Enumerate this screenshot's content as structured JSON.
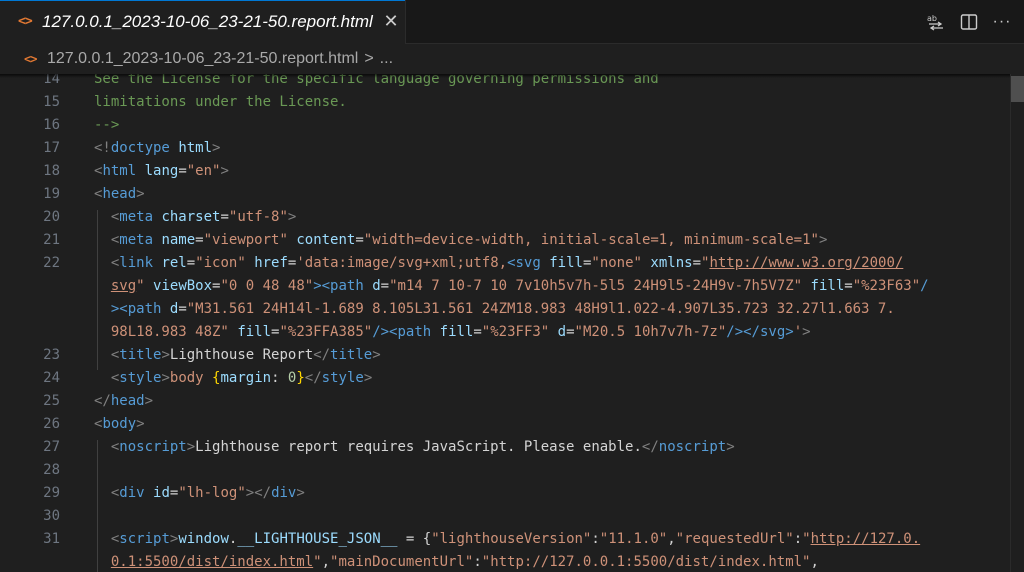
{
  "tab": {
    "icon": "<>",
    "title": "127.0.0.1_2023-10-06_23-21-50.report.html",
    "close": "✕"
  },
  "actions": {
    "icons": [
      "compare-changes-icon",
      "split-editor-icon",
      "more-actions-icon"
    ],
    "more": "···"
  },
  "breadcrumb": {
    "icon": "<>",
    "file": "127.0.0.1_2023-10-06_23-21-50.report.html",
    "separator": ">",
    "more": "..."
  },
  "editor": {
    "line_numbers": [
      "14",
      "15",
      "16",
      "17",
      "18",
      "19",
      "20",
      "21",
      "22",
      "23",
      "24",
      "25",
      "26",
      "27",
      "28",
      "29",
      "30",
      "31"
    ],
    "lines": [
      {
        "number": "14",
        "tokens": [
          {
            "t": "com",
            "v": "See the License for the specific language governing permissions and"
          }
        ]
      },
      {
        "number": "15",
        "tokens": [
          {
            "t": "com",
            "v": "limitations under the License."
          }
        ]
      },
      {
        "number": "16",
        "tokens": [
          {
            "t": "com",
            "v": "-->"
          }
        ]
      },
      {
        "number": "17",
        "tokens": [
          {
            "t": "br",
            "v": "<!"
          },
          {
            "t": "tag",
            "v": "doctype"
          },
          {
            "t": "txt",
            "v": " "
          },
          {
            "t": "attr",
            "v": "html"
          },
          {
            "t": "br",
            "v": ">"
          }
        ]
      },
      {
        "number": "18",
        "tokens": [
          {
            "t": "br",
            "v": "<"
          },
          {
            "t": "tag",
            "v": "html"
          },
          {
            "t": "txt",
            "v": " "
          },
          {
            "t": "attr",
            "v": "lang"
          },
          {
            "t": "txt",
            "v": "="
          },
          {
            "t": "str",
            "v": "\"en\""
          },
          {
            "t": "br",
            "v": ">"
          }
        ]
      },
      {
        "number": "19",
        "tokens": [
          {
            "t": "br",
            "v": "<"
          },
          {
            "t": "tag",
            "v": "head"
          },
          {
            "t": "br",
            "v": ">"
          }
        ]
      },
      {
        "number": "20",
        "tokens": [
          {
            "t": "txt",
            "v": "  "
          },
          {
            "t": "br",
            "v": "<"
          },
          {
            "t": "tag",
            "v": "meta"
          },
          {
            "t": "txt",
            "v": " "
          },
          {
            "t": "attr",
            "v": "charset"
          },
          {
            "t": "txt",
            "v": "="
          },
          {
            "t": "str",
            "v": "\"utf-8\""
          },
          {
            "t": "br",
            "v": ">"
          }
        ]
      },
      {
        "number": "21",
        "tokens": [
          {
            "t": "txt",
            "v": "  "
          },
          {
            "t": "br",
            "v": "<"
          },
          {
            "t": "tag",
            "v": "meta"
          },
          {
            "t": "txt",
            "v": " "
          },
          {
            "t": "attr",
            "v": "name"
          },
          {
            "t": "txt",
            "v": "="
          },
          {
            "t": "str",
            "v": "\"viewport\""
          },
          {
            "t": "txt",
            "v": " "
          },
          {
            "t": "attr",
            "v": "content"
          },
          {
            "t": "txt",
            "v": "="
          },
          {
            "t": "str",
            "v": "\"width=device-width, initial-scale=1, minimum-scale=1\""
          },
          {
            "t": "br",
            "v": ">"
          }
        ]
      },
      {
        "number": "22",
        "tokens": [
          {
            "t": "txt",
            "v": "  "
          },
          {
            "t": "br",
            "v": "<"
          },
          {
            "t": "tag",
            "v": "link"
          },
          {
            "t": "txt",
            "v": " "
          },
          {
            "t": "attr",
            "v": "rel"
          },
          {
            "t": "txt",
            "v": "="
          },
          {
            "t": "str",
            "v": "\"icon\""
          },
          {
            "t": "txt",
            "v": " "
          },
          {
            "t": "attr",
            "v": "href"
          },
          {
            "t": "txt",
            "v": "="
          },
          {
            "t": "str",
            "v": "'data:image/svg+xml;utf8,"
          },
          {
            "t": "tag",
            "v": "<svg"
          },
          {
            "t": "txt",
            "v": " "
          },
          {
            "t": "attr",
            "v": "fill"
          },
          {
            "t": "txt",
            "v": "="
          },
          {
            "t": "str",
            "v": "\"none\""
          },
          {
            "t": "txt",
            "v": " "
          },
          {
            "t": "attr",
            "v": "xmlns"
          },
          {
            "t": "txt",
            "v": "="
          },
          {
            "t": "str",
            "v": "\""
          },
          {
            "t": "link",
            "v": "http://www.w3.org/2000/"
          }
        ]
      },
      {
        "number": "",
        "tokens": [
          {
            "t": "txt",
            "v": "  "
          },
          {
            "t": "link",
            "v": "svg"
          },
          {
            "t": "str",
            "v": "\""
          },
          {
            "t": "txt",
            "v": " "
          },
          {
            "t": "attr",
            "v": "viewBox"
          },
          {
            "t": "txt",
            "v": "="
          },
          {
            "t": "str",
            "v": "\"0 0 48 48\""
          },
          {
            "t": "tag",
            "v": "><path"
          },
          {
            "t": "txt",
            "v": " "
          },
          {
            "t": "attr",
            "v": "d"
          },
          {
            "t": "txt",
            "v": "="
          },
          {
            "t": "str",
            "v": "\"m14 7 10-7 10 7v10h5v7h-5l5 24H9l5-24H9v-7h5V7Z\""
          },
          {
            "t": "txt",
            "v": " "
          },
          {
            "t": "attr",
            "v": "fill"
          },
          {
            "t": "txt",
            "v": "="
          },
          {
            "t": "str",
            "v": "\"%23F63\""
          },
          {
            "t": "tag",
            "v": "/"
          }
        ]
      },
      {
        "number": "",
        "tokens": [
          {
            "t": "txt",
            "v": "  "
          },
          {
            "t": "tag",
            "v": "><path"
          },
          {
            "t": "txt",
            "v": " "
          },
          {
            "t": "attr",
            "v": "d"
          },
          {
            "t": "txt",
            "v": "="
          },
          {
            "t": "str",
            "v": "\"M31.561 24H14l-1.689 8.105L31.561 24ZM18.983 48H9l1.022-4.907L35.723 32.27l1.663 7."
          }
        ]
      },
      {
        "number": "",
        "tokens": [
          {
            "t": "txt",
            "v": "  "
          },
          {
            "t": "str",
            "v": "98L18.983 48Z\""
          },
          {
            "t": "txt",
            "v": " "
          },
          {
            "t": "attr",
            "v": "fill"
          },
          {
            "t": "txt",
            "v": "="
          },
          {
            "t": "str",
            "v": "\"%23FFA385\""
          },
          {
            "t": "tag",
            "v": "/><path"
          },
          {
            "t": "txt",
            "v": " "
          },
          {
            "t": "attr",
            "v": "fill"
          },
          {
            "t": "txt",
            "v": "="
          },
          {
            "t": "str",
            "v": "\"%23FF3\""
          },
          {
            "t": "txt",
            "v": " "
          },
          {
            "t": "attr",
            "v": "d"
          },
          {
            "t": "txt",
            "v": "="
          },
          {
            "t": "str",
            "v": "\"M20.5 10h7v7h-7z\""
          },
          {
            "t": "tag",
            "v": "/></svg>"
          },
          {
            "t": "str",
            "v": "'"
          },
          {
            "t": "br",
            "v": ">"
          }
        ]
      },
      {
        "number": "23",
        "tokens": [
          {
            "t": "txt",
            "v": "  "
          },
          {
            "t": "br",
            "v": "<"
          },
          {
            "t": "tag",
            "v": "title"
          },
          {
            "t": "br",
            "v": ">"
          },
          {
            "t": "txt",
            "v": "Lighthouse Report"
          },
          {
            "t": "br",
            "v": "</"
          },
          {
            "t": "tag",
            "v": "title"
          },
          {
            "t": "br",
            "v": ">"
          }
        ]
      },
      {
        "number": "24",
        "tokens": [
          {
            "t": "txt",
            "v": "  "
          },
          {
            "t": "br",
            "v": "<"
          },
          {
            "t": "tag",
            "v": "style"
          },
          {
            "t": "br",
            "v": ">"
          },
          {
            "t": "str",
            "v": "body"
          },
          {
            "t": "txt",
            "v": " "
          },
          {
            "t": "brace",
            "v": "{"
          },
          {
            "t": "attr",
            "v": "margin"
          },
          {
            "t": "txt",
            "v": ": "
          },
          {
            "t": "num",
            "v": "0"
          },
          {
            "t": "brace",
            "v": "}"
          },
          {
            "t": "br",
            "v": "</"
          },
          {
            "t": "tag",
            "v": "style"
          },
          {
            "t": "br",
            "v": ">"
          }
        ]
      },
      {
        "number": "25",
        "tokens": [
          {
            "t": "br",
            "v": "</"
          },
          {
            "t": "tag",
            "v": "head"
          },
          {
            "t": "br",
            "v": ">"
          }
        ]
      },
      {
        "number": "26",
        "tokens": [
          {
            "t": "br",
            "v": "<"
          },
          {
            "t": "tag",
            "v": "body"
          },
          {
            "t": "br",
            "v": ">"
          }
        ]
      },
      {
        "number": "27",
        "tokens": [
          {
            "t": "txt",
            "v": "  "
          },
          {
            "t": "br",
            "v": "<"
          },
          {
            "t": "tag",
            "v": "noscript"
          },
          {
            "t": "br",
            "v": ">"
          },
          {
            "t": "txt",
            "v": "Lighthouse report requires JavaScript. Please enable."
          },
          {
            "t": "br",
            "v": "</"
          },
          {
            "t": "tag",
            "v": "noscript"
          },
          {
            "t": "br",
            "v": ">"
          }
        ]
      },
      {
        "number": "28",
        "tokens": []
      },
      {
        "number": "29",
        "tokens": [
          {
            "t": "txt",
            "v": "  "
          },
          {
            "t": "br",
            "v": "<"
          },
          {
            "t": "tag",
            "v": "div"
          },
          {
            "t": "txt",
            "v": " "
          },
          {
            "t": "attr",
            "v": "id"
          },
          {
            "t": "txt",
            "v": "="
          },
          {
            "t": "str",
            "v": "\"lh-log\""
          },
          {
            "t": "br",
            "v": "></"
          },
          {
            "t": "tag",
            "v": "div"
          },
          {
            "t": "br",
            "v": ">"
          }
        ]
      },
      {
        "number": "30",
        "tokens": []
      },
      {
        "number": "31",
        "tokens": [
          {
            "t": "txt",
            "v": "  "
          },
          {
            "t": "br",
            "v": "<"
          },
          {
            "t": "tag",
            "v": "script"
          },
          {
            "t": "br",
            "v": ">"
          },
          {
            "t": "var",
            "v": "window"
          },
          {
            "t": "txt",
            "v": "."
          },
          {
            "t": "var",
            "v": "__LIGHTHOUSE_JSON__"
          },
          {
            "t": "txt",
            "v": " = {"
          },
          {
            "t": "str",
            "v": "\"lighthouseVersion\""
          },
          {
            "t": "txt",
            "v": ":"
          },
          {
            "t": "str",
            "v": "\"11.1.0\""
          },
          {
            "t": "txt",
            "v": ","
          },
          {
            "t": "str",
            "v": "\"requestedUrl\""
          },
          {
            "t": "txt",
            "v": ":"
          },
          {
            "t": "str",
            "v": "\""
          },
          {
            "t": "link",
            "v": "http://127.0."
          }
        ]
      },
      {
        "number": "",
        "tokens": [
          {
            "t": "txt",
            "v": "  "
          },
          {
            "t": "link",
            "v": "0.1:5500/dist/index.html"
          },
          {
            "t": "str",
            "v": "\""
          },
          {
            "t": "txt",
            "v": ","
          },
          {
            "t": "str",
            "v": "\"mainDocumentUrl\""
          },
          {
            "t": "txt",
            "v": ":"
          },
          {
            "t": "str",
            "v": "\"http://127.0.0.1:5500/dist/index.html\""
          },
          {
            "t": "txt",
            "v": ","
          }
        ]
      }
    ]
  }
}
